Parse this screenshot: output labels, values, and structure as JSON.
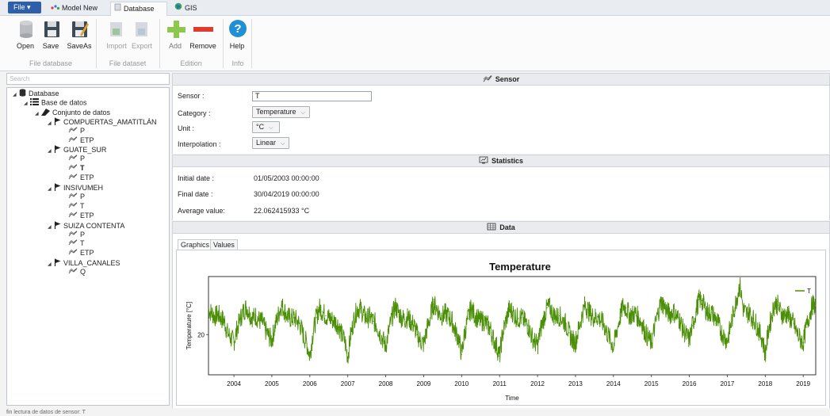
{
  "tabs": {
    "file": "File ▾",
    "model_new": "Model New",
    "database": "Database",
    "gis": "GIS"
  },
  "ribbon": {
    "buttons": {
      "open": "Open",
      "save": "Save",
      "saveas": "SaveAs",
      "import": "Import",
      "export": "Export",
      "add": "Add",
      "remove": "Remove",
      "help": "Help"
    },
    "groups": {
      "file_database": "File database",
      "file_dataset": "File dataset",
      "edition": "Edition",
      "info": "Info"
    }
  },
  "search": {
    "placeholder": "Search"
  },
  "tree": {
    "database": "Database",
    "base": "Base de datos",
    "conjunto": "Conjunto de datos",
    "stations": [
      {
        "name": "COMPUERTAS_AMATITLÁN",
        "sensors": [
          "P",
          "ETP"
        ]
      },
      {
        "name": "GUATE_SUR",
        "sensors": [
          "P",
          "T",
          "ETP"
        ]
      },
      {
        "name": "INSIVUMEH",
        "sensors": [
          "P",
          "T",
          "ETP"
        ]
      },
      {
        "name": "SUIZA CONTENTA",
        "sensors": [
          "P",
          "T",
          "ETP"
        ]
      },
      {
        "name": "VILLA_CANALES",
        "sensors": [
          "Q"
        ]
      }
    ]
  },
  "sensor": {
    "header": "Sensor",
    "labels": {
      "sensor": "Sensor :",
      "category": "Category :",
      "unit": "Unit :",
      "interpolation": "Interpolation :"
    },
    "values": {
      "sensor": "T",
      "category": "Temperature",
      "unit": "°C",
      "interpolation": "Linear"
    }
  },
  "statistics": {
    "header": "Statistics",
    "labels": {
      "initial": "Initial date :",
      "final": "Final date :",
      "average": "Average value:"
    },
    "values": {
      "initial": "01/05/2003 00:00:00",
      "final": "30/04/2019 00:00:00",
      "average": "22.062415933   °C"
    }
  },
  "data": {
    "header": "Data",
    "tabs": {
      "graphics": "Graphics",
      "values": "Values"
    }
  },
  "status": {
    "text": "fin lectura de datos de sensor: T"
  },
  "colors": {
    "series": "#4a8f06",
    "accent": "#2f5fa9"
  },
  "chart_data": {
    "type": "line",
    "title": "Temperature",
    "xlabel": "Time",
    "ylabel": "Temperature [°C]",
    "x_ticks": [
      "2004",
      "2005",
      "2006",
      "2007",
      "2008",
      "2009",
      "2010",
      "2011",
      "2012",
      "2013",
      "2014",
      "2015",
      "2016",
      "2017",
      "2018",
      "2019"
    ],
    "y_ticks": [
      "20"
    ],
    "xlim": [
      2003.33,
      2019.33
    ],
    "ylim": [
      15.5,
      26.5
    ],
    "legend": "top-right",
    "grid": false,
    "series": [
      {
        "name": "T",
        "sampling": "monthly",
        "x": [
          2003.33,
          2003.42,
          2003.5,
          2003.58,
          2003.67,
          2003.75,
          2003.83,
          2003.92,
          2004.0,
          2004.08,
          2004.17,
          2004.25,
          2004.33,
          2004.42,
          2004.5,
          2004.58,
          2004.67,
          2004.75,
          2004.83,
          2004.92,
          2005.0,
          2005.08,
          2005.17,
          2005.25,
          2005.33,
          2005.42,
          2005.5,
          2005.58,
          2005.67,
          2005.75,
          2005.83,
          2005.92,
          2006.0,
          2006.08,
          2006.17,
          2006.25,
          2006.33,
          2006.42,
          2006.5,
          2006.58,
          2006.67,
          2006.75,
          2006.83,
          2006.92,
          2007.0,
          2007.08,
          2007.17,
          2007.25,
          2007.33,
          2007.42,
          2007.5,
          2007.58,
          2007.67,
          2007.75,
          2007.83,
          2007.92,
          2008.0,
          2008.08,
          2008.17,
          2008.25,
          2008.33,
          2008.42,
          2008.5,
          2008.58,
          2008.67,
          2008.75,
          2008.83,
          2008.92,
          2009.0,
          2009.08,
          2009.17,
          2009.25,
          2009.33,
          2009.42,
          2009.5,
          2009.58,
          2009.67,
          2009.75,
          2009.83,
          2009.92,
          2010.0,
          2010.08,
          2010.17,
          2010.25,
          2010.33,
          2010.42,
          2010.5,
          2010.58,
          2010.67,
          2010.75,
          2010.83,
          2010.92,
          2011.0,
          2011.08,
          2011.17,
          2011.25,
          2011.33,
          2011.42,
          2011.5,
          2011.58,
          2011.67,
          2011.75,
          2011.83,
          2011.92,
          2012.0,
          2012.08,
          2012.17,
          2012.25,
          2012.33,
          2012.42,
          2012.5,
          2012.58,
          2012.67,
          2012.75,
          2012.83,
          2012.92,
          2013.0,
          2013.08,
          2013.17,
          2013.25,
          2013.33,
          2013.42,
          2013.5,
          2013.58,
          2013.67,
          2013.75,
          2013.83,
          2013.92,
          2014.0,
          2014.08,
          2014.17,
          2014.25,
          2014.33,
          2014.42,
          2014.5,
          2014.58,
          2014.67,
          2014.75,
          2014.83,
          2014.92,
          2015.0,
          2015.08,
          2015.17,
          2015.25,
          2015.33,
          2015.42,
          2015.5,
          2015.58,
          2015.67,
          2015.75,
          2015.83,
          2015.92,
          2016.0,
          2016.08,
          2016.17,
          2016.25,
          2016.33,
          2016.42,
          2016.5,
          2016.58,
          2016.67,
          2016.75,
          2016.83,
          2016.92,
          2017.0,
          2017.08,
          2017.17,
          2017.25,
          2017.33,
          2017.42,
          2017.5,
          2017.58,
          2017.67,
          2017.75,
          2017.83,
          2017.92,
          2018.0,
          2018.08,
          2018.17,
          2018.25,
          2018.33,
          2018.42,
          2018.5,
          2018.58,
          2018.67,
          2018.75,
          2018.83,
          2018.92,
          2019.0,
          2019.08,
          2019.17,
          2019.25,
          2019.33
        ],
        "values": [
          22.8,
          22.4,
          22.0,
          22.3,
          21.8,
          21.5,
          20.2,
          19.6,
          19.2,
          20.6,
          21.8,
          22.6,
          23.1,
          22.3,
          21.9,
          22.1,
          21.6,
          21.4,
          20.5,
          19.8,
          19.4,
          20.9,
          22.2,
          23.3,
          22.7,
          22.0,
          21.8,
          21.9,
          21.5,
          21.0,
          19.9,
          19.0,
          17.6,
          20.1,
          21.9,
          23.0,
          22.6,
          22.1,
          21.9,
          21.7,
          21.4,
          21.1,
          20.1,
          19.3,
          17.5,
          20.0,
          21.8,
          22.9,
          22.9,
          22.2,
          21.8,
          22.0,
          21.5,
          21.2,
          20.3,
          19.5,
          18.7,
          20.4,
          22.0,
          23.2,
          22.5,
          21.9,
          21.7,
          21.9,
          21.4,
          21.0,
          20.0,
          19.3,
          18.9,
          20.5,
          21.9,
          23.4,
          23.1,
          22.3,
          22.1,
          22.4,
          21.9,
          21.5,
          20.4,
          19.6,
          17.8,
          20.2,
          21.8,
          23.0,
          22.3,
          21.8,
          21.5,
          21.6,
          21.1,
          20.7,
          19.6,
          18.7,
          17.6,
          20.1,
          21.6,
          22.8,
          22.6,
          22.0,
          21.8,
          21.9,
          21.4,
          21.0,
          20.0,
          19.2,
          18.8,
          20.5,
          21.9,
          23.0,
          23.0,
          22.2,
          22.0,
          22.1,
          21.6,
          21.2,
          20.2,
          19.4,
          19.1,
          20.6,
          22.1,
          23.3,
          22.8,
          22.1,
          21.9,
          22.0,
          21.6,
          21.1,
          20.2,
          19.4,
          18.6,
          20.3,
          21.9,
          23.2,
          23.0,
          22.2,
          22.2,
          22.4,
          21.8,
          21.3,
          20.3,
          19.6,
          19.0,
          20.7,
          22.3,
          23.6,
          23.3,
          22.5,
          22.3,
          22.6,
          22.0,
          21.6,
          20.6,
          19.9,
          19.4,
          21.0,
          22.5,
          23.9,
          23.8,
          22.9,
          22.4,
          22.5,
          21.9,
          21.4,
          20.4,
          19.7,
          19.3,
          20.8,
          22.6,
          24.1,
          25.6,
          22.9,
          22.3,
          22.5,
          21.8,
          21.3,
          20.4,
          19.6,
          17.8,
          20.4,
          22.1,
          23.5,
          23.3,
          22.4,
          22.1,
          22.3,
          21.7,
          21.2,
          20.2,
          19.5,
          19.1,
          20.8,
          22.3,
          23.4,
          23.2
        ]
      }
    ]
  }
}
